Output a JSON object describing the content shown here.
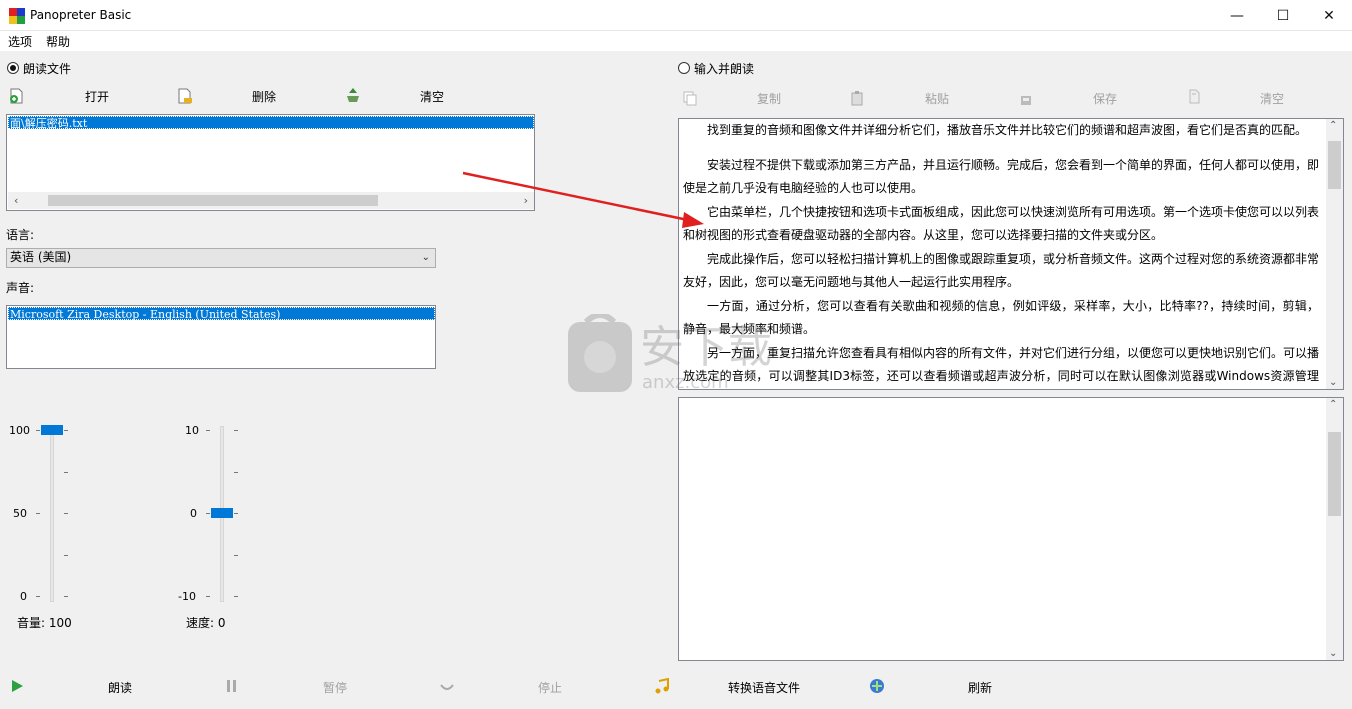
{
  "window": {
    "title": "Panopreter Basic"
  },
  "menu": [
    "选项",
    "帮助"
  ],
  "left": {
    "mode_label": "朗读文件",
    "toolbar": {
      "open": "打开",
      "delete": "删除",
      "clear": "清空"
    },
    "file_list": [
      "面\\解压密码.txt"
    ],
    "language_label": "语言:",
    "language_value": "英语 (美国)",
    "voice_label": "声音:",
    "voice_list": [
      "Microsoft Zira Desktop - English (United States)"
    ],
    "volume": {
      "max": "100",
      "mid": "50",
      "min": "0",
      "label": "音量: 100",
      "value": 100
    },
    "speed": {
      "max": "10",
      "mid": "0",
      "min": "-10",
      "label": "速度: 0",
      "value": 0
    }
  },
  "right": {
    "mode_label": "输入并朗读",
    "toolbar": {
      "copy": "复制",
      "paste": "粘贴",
      "save": "保存",
      "clear": "清空"
    },
    "paragraphs": [
      "找到重复的音频和图像文件并详细分析它们，播放音乐文件并比较它们的频谱和超声波图，看它们是否真的匹配。",
      "安装过程不提供下载或添加第三方产品，并且运行顺畅。完成后，您会看到一个简单的界面，任何人都可以使用，即使是之前几乎没有电脑经验的人也可以使用。",
      "它由菜单栏，几个快捷按钮和选项卡式面板组成，因此您可以快速浏览所有可用选项。第一个选项卡使您可以以列表和树视图的形式查看硬盘驱动器的全部内容。从这里，您可以选择要扫描的文件夹或分区。",
      "完成此操作后，您可以轻松扫描计算机上的图像或跟踪重复项，或分析音频文件。这两个过程对您的系统资源都非常友好，因此，您可以毫无问题地与其他人一起运行此实用程序。",
      "一方面，通过分析，您可以查看有关歌曲和视频的信息，例如评级，采样率，大小，比特率??，持续时间，剪辑，静音，最大频率和频谱。",
      "另一方面，重复扫描允许您查看具有相似内容的所有文件，并对它们进行分组，以便您可以更快地识别它们。可以播放选定的音频，可以调整其ID3标签，还可以查看频谱或超声波分析，同时可以在默认图像浏览器或Windows资源管理器中打开照片。两种类型的文件都可以标记，移动到自定义位置或从硬盘驱动器中删除。"
    ]
  },
  "bottom": {
    "read": "朗读",
    "pause": "暂停",
    "stop": "停止",
    "convert": "转换语音文件",
    "refresh": "刷新"
  },
  "colors": {
    "accent": "#0078d7",
    "arrow": "#e02020"
  }
}
